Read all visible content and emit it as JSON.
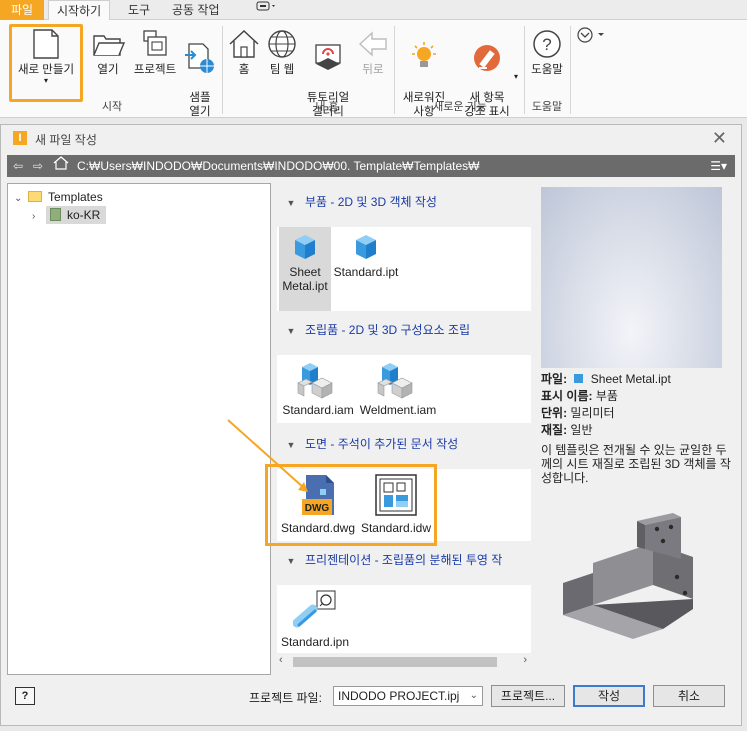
{
  "ribbon": {
    "tabs": [
      {
        "label": "파일"
      },
      {
        "label": "시작하기"
      },
      {
        "label": "도구"
      },
      {
        "label": "공동 작업"
      }
    ],
    "buttons": {
      "new": "새로 만들기",
      "open": "열기",
      "projects": "프로젝트",
      "open_samples": "샘플\n열기",
      "home": "홈",
      "team_web": "팀 웹",
      "tutorial_gallery": "튜토리얼\n갤러리",
      "back": "뒤로",
      "whats_new": "새로워진\n사항",
      "highlight_new": "새 항목\n강조 표시",
      "help": "도움말"
    },
    "groups": {
      "start": "시작",
      "my_home": "내 홈",
      "new_features": "새로운 기능",
      "help": "도움말"
    }
  },
  "dialog": {
    "title": "새 파일 작성",
    "path": "C:₩Users₩INDODO₩Documents₩INDODO₩00. Template₩Templates₩",
    "tree": {
      "root": "Templates",
      "child": "ko-KR"
    },
    "categories": [
      {
        "title": "부품 - 2D 및 3D 객체 작성",
        "items": [
          "Sheet\nMetal.ipt",
          "Standard.ipt"
        ]
      },
      {
        "title": "조립품 - 2D 및 3D 구성요소 조립",
        "items": [
          "Standard.iam",
          "Weldment.iam"
        ]
      },
      {
        "title": "도면 - 주석이 추가된 문서 작성",
        "items": [
          "Standard.dwg",
          "Standard.idw"
        ]
      },
      {
        "title": "프리젠테이션 - 조립품의 분해된 투영 작",
        "items": [
          "Standard.ipn"
        ]
      }
    ],
    "properties": {
      "file_label": "파일:",
      "file_value": "Sheet Metal.ipt",
      "display_name_label": "표시 이름:",
      "display_name_value": "부품",
      "units_label": "단위:",
      "units_value": "밀리미터",
      "material_label": "재질:",
      "material_value": "일반"
    },
    "description": "이 템플릿은 전개될 수 있는 균일한 두께의 시트 재질로 조립된 3D 객체를 작성합니다.",
    "footer": {
      "help": "?",
      "project_file_label": "프로젝트 파일:",
      "project_file_value": "INDODO PROJECT.ipj",
      "projects_button": "프로젝트...",
      "create_button": "작성",
      "cancel_button": "취소"
    }
  },
  "colors": {
    "accent_orange": "#f5a623",
    "category_blue": "#1a3aa6",
    "path_bar": "#6b6b6b"
  }
}
